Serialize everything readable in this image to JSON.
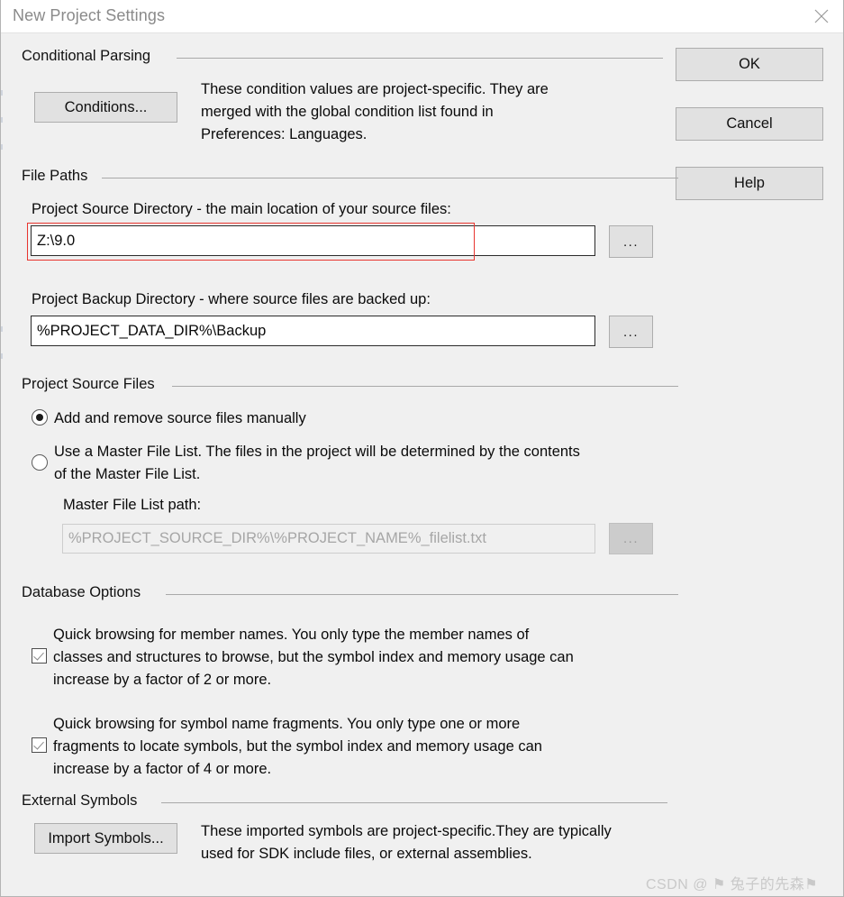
{
  "window": {
    "title": "New Project Settings",
    "close_icon": "close-icon"
  },
  "actions": {
    "ok": "OK",
    "cancel": "Cancel",
    "help": "Help"
  },
  "groups": {
    "conditional_parsing": {
      "title": "Conditional Parsing",
      "button": "Conditions...",
      "description": "These condition values are project-specific.  They are\nmerged with the global condition list found in\nPreferences: Languages."
    },
    "file_paths": {
      "title": "File Paths",
      "source_label": "Project Source Directory - the main location of your source files:",
      "source_value": "Z:\\9.0",
      "source_browse": "...",
      "backup_label": "Project Backup Directory - where source files are backed up:",
      "backup_value": "%PROJECT_DATA_DIR%\\Backup",
      "backup_browse": "..."
    },
    "project_source_files": {
      "title": "Project Source Files",
      "radio_manual": "Add and remove source files manually",
      "radio_masterlist": "Use a Master File List. The files in the project will be determined by the contents\nof the Master File List.",
      "selected": "manual",
      "master_path_label": "Master File List path:",
      "master_path_value": "%PROJECT_SOURCE_DIR%\\%PROJECT_NAME%_filelist.txt",
      "master_browse": "..."
    },
    "database_options": {
      "title": "Database Options",
      "option1_text": "Quick browsing for member names.  You only type the member names of\nclasses and structures to browse, but the symbol index and memory usage can\nincrease by a factor of 2 or more.",
      "option1_checked": true,
      "option2_text": "Quick browsing for symbol name fragments.  You only type one or more\nfragments to locate symbols, but the symbol index and memory usage can\nincrease by a factor of 4 or more.",
      "option2_checked": true
    },
    "external_symbols": {
      "title": "External Symbols",
      "button": "Import Symbols...",
      "description": "These imported symbols are project-specific.They are typically\nused for SDK include files, or external assemblies."
    }
  },
  "watermark": {
    "text": "CSDN @ ⚑ 兔子的先森⚑"
  },
  "colors": {
    "dialog_bg": "#f0f0f0",
    "title_bg": "#ffffff",
    "accent_annotation": "#e8352f",
    "button_face": "#e1e1e1",
    "text": "#0a0a0a"
  }
}
